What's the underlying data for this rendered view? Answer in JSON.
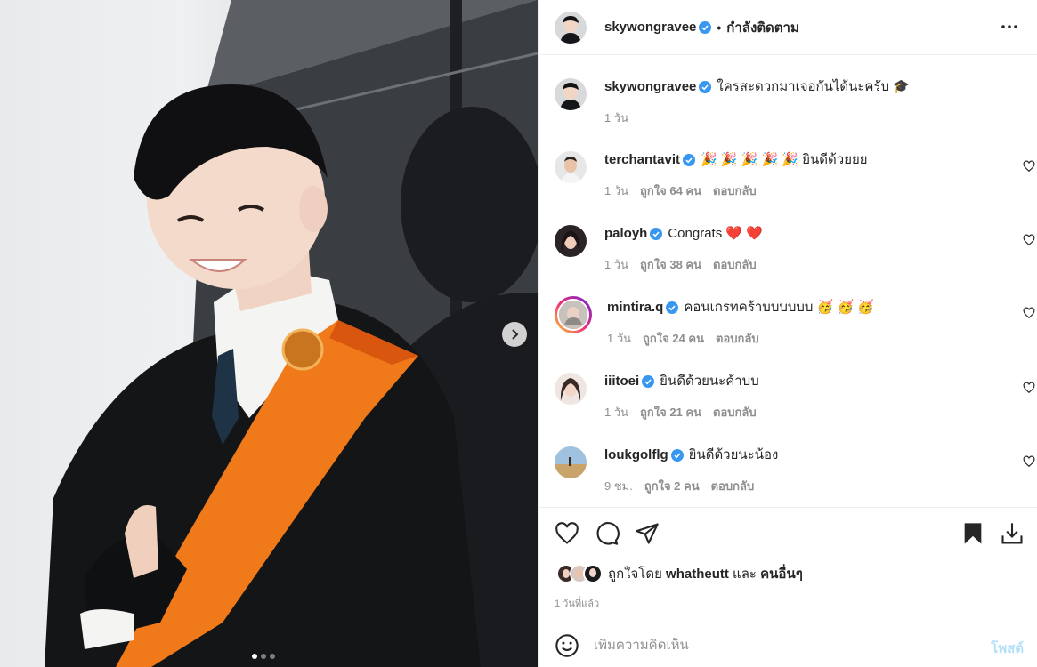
{
  "header": {
    "username": "skywongravee",
    "separator": "•",
    "follow_label": "กำลังติดตาม"
  },
  "caption": {
    "username": "skywongravee",
    "text": "ใครสะดวกมาเจอกันได้นะครับ 🎓",
    "time": "1 วัน"
  },
  "comments": [
    {
      "username": "terchantavit",
      "text": "🎉 🎉 🎉 🎉 🎉 ยินดีด้วยยย",
      "time": "1 วัน",
      "likes": "ถูกใจ 64 คน",
      "reply": "ตอบกลับ"
    },
    {
      "username": "paloyh",
      "text": "Congrats ❤️ ❤️",
      "time": "1 วัน",
      "likes": "ถูกใจ 38 คน",
      "reply": "ตอบกลับ"
    },
    {
      "username": "mintira.q",
      "text": "คอนเกรทคร้าบบบบบบ 🥳 🥳 🥳",
      "time": "1 วัน",
      "likes": "ถูกใจ 24 คน",
      "reply": "ตอบกลับ"
    },
    {
      "username": "iiitoei",
      "text": "ยินดีด้วยนะค้าบบ",
      "time": "1 วัน",
      "likes": "ถูกใจ 21 คน",
      "reply": "ตอบกลับ"
    },
    {
      "username": "loukgolflg",
      "text": "ยินดีด้วยนะน้อง",
      "time": "9 ชม.",
      "likes": "ถูกใจ 2 คน",
      "reply": "ตอบกลับ"
    }
  ],
  "likes_summary": {
    "prefix": "ถูกใจโดย",
    "user": "whatheutt",
    "conj": "และ",
    "others": "คนอื่นๆ"
  },
  "post_time": "1 วันที่แล้ว",
  "add_comment": {
    "placeholder": "เพิ่มความคิดเห็น",
    "post_label": "โพสต์"
  },
  "carousel": {
    "current": 1,
    "total": 3
  },
  "colors": {
    "verified": "#3897f0",
    "post_button_disabled": "#b2dffc",
    "sash": "#f07a1a",
    "gown": "#111214",
    "meta_text": "#8e8e8e"
  },
  "icons": [
    "more-options-icon",
    "carousel-next-icon",
    "heart-icon",
    "comment-icon",
    "share-icon",
    "save-icon",
    "download-icon",
    "emoji-icon",
    "verified-badge-icon"
  ]
}
